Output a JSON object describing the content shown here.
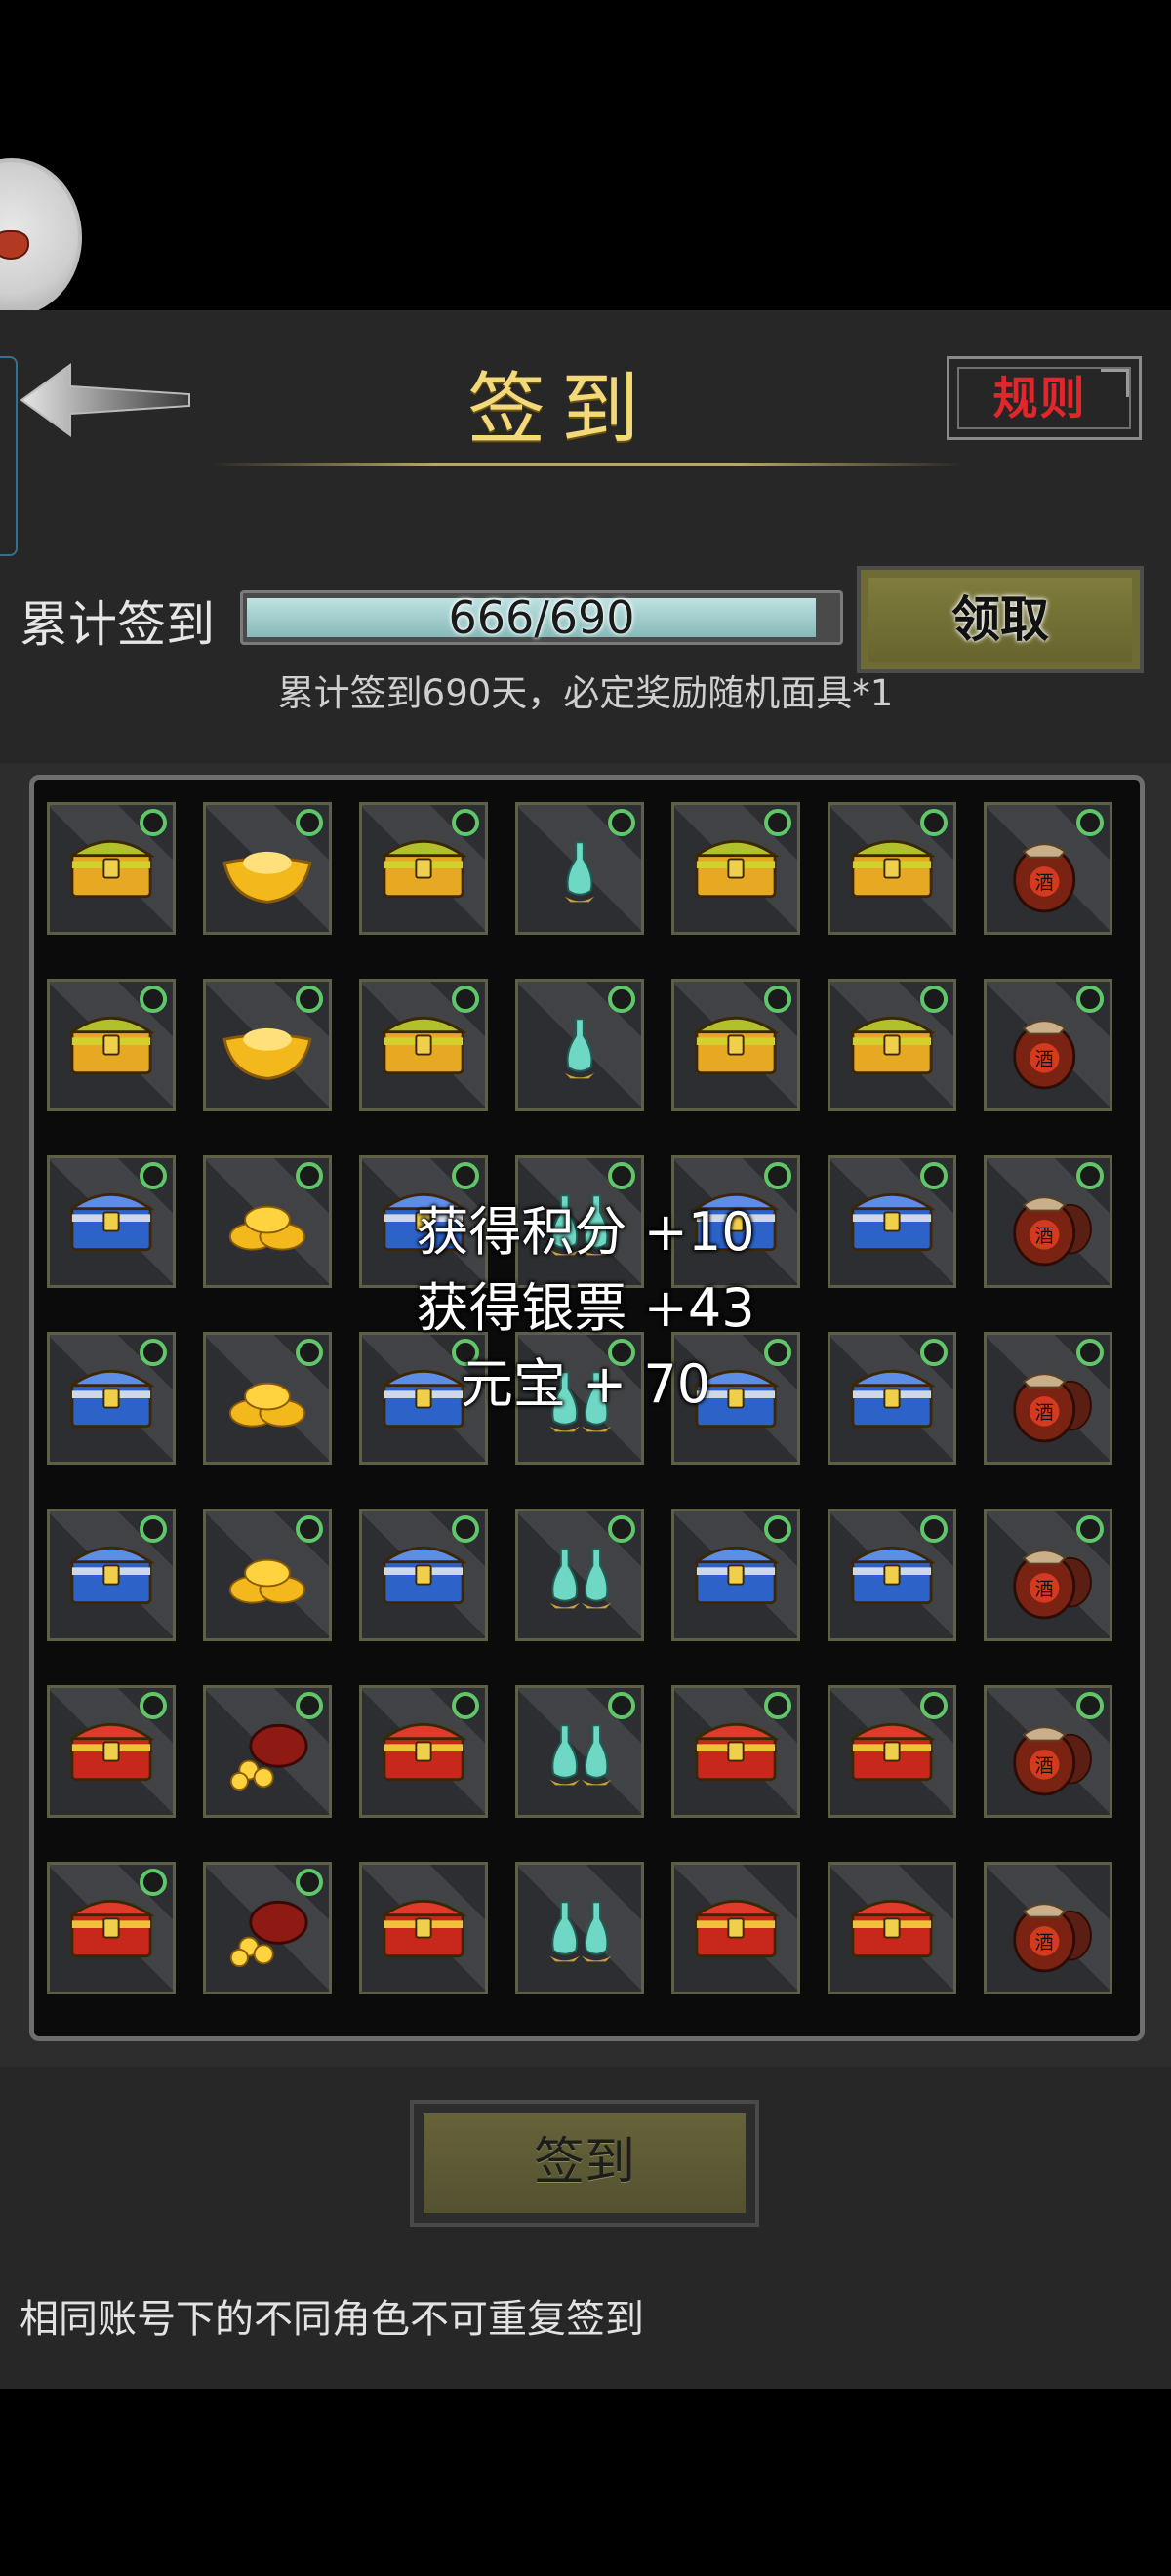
{
  "header": {
    "title": "签到",
    "rules_label": "规则"
  },
  "progress": {
    "label": "累计签到",
    "text": "666/690",
    "current": 666,
    "total": 690,
    "claim_label": "领取",
    "note": "累计签到690天，必定奖励随机面具*1"
  },
  "grid": {
    "rows": [
      [
        {
          "item": "chest-gold",
          "claimed": true
        },
        {
          "item": "gold-ingot",
          "claimed": true
        },
        {
          "item": "chest-gold",
          "claimed": true
        },
        {
          "item": "jade-vase",
          "claimed": true
        },
        {
          "item": "chest-gold",
          "claimed": true
        },
        {
          "item": "chest-gold",
          "claimed": true
        },
        {
          "item": "wine-jar",
          "claimed": true
        }
      ],
      [
        {
          "item": "chest-gold",
          "claimed": true
        },
        {
          "item": "gold-ingot",
          "claimed": true
        },
        {
          "item": "chest-gold",
          "claimed": true
        },
        {
          "item": "jade-vase",
          "claimed": true
        },
        {
          "item": "chest-gold",
          "claimed": true
        },
        {
          "item": "chest-gold",
          "claimed": true
        },
        {
          "item": "wine-jar",
          "claimed": true
        }
      ],
      [
        {
          "item": "chest-blue",
          "claimed": true
        },
        {
          "item": "gold-ingot-pile",
          "claimed": true
        },
        {
          "item": "chest-blue",
          "claimed": true
        },
        {
          "item": "jade-vases",
          "claimed": true
        },
        {
          "item": "chest-blue",
          "claimed": true
        },
        {
          "item": "chest-blue",
          "claimed": true
        },
        {
          "item": "wine-jars",
          "claimed": true
        }
      ],
      [
        {
          "item": "chest-blue",
          "claimed": true
        },
        {
          "item": "gold-ingot-pile",
          "claimed": true
        },
        {
          "item": "chest-blue",
          "claimed": true
        },
        {
          "item": "jade-vases",
          "claimed": true
        },
        {
          "item": "chest-blue",
          "claimed": true
        },
        {
          "item": "chest-blue",
          "claimed": true
        },
        {
          "item": "wine-jars",
          "claimed": true
        }
      ],
      [
        {
          "item": "chest-blue",
          "claimed": true
        },
        {
          "item": "gold-ingot-pile",
          "claimed": true
        },
        {
          "item": "chest-blue",
          "claimed": true
        },
        {
          "item": "jade-vases",
          "claimed": true
        },
        {
          "item": "chest-blue",
          "claimed": true
        },
        {
          "item": "chest-blue",
          "claimed": true
        },
        {
          "item": "wine-jars",
          "claimed": true
        }
      ],
      [
        {
          "item": "chest-red",
          "claimed": true
        },
        {
          "item": "coin-bag",
          "claimed": true
        },
        {
          "item": "chest-red",
          "claimed": true
        },
        {
          "item": "jade-vases",
          "claimed": true
        },
        {
          "item": "chest-red",
          "claimed": true
        },
        {
          "item": "chest-red",
          "claimed": true
        },
        {
          "item": "wine-jars",
          "claimed": true
        }
      ],
      [
        {
          "item": "chest-red",
          "claimed": true
        },
        {
          "item": "coin-bag",
          "claimed": true
        },
        {
          "item": "chest-red",
          "claimed": false
        },
        {
          "item": "jade-vases",
          "claimed": false
        },
        {
          "item": "chest-red",
          "claimed": false
        },
        {
          "item": "chest-red",
          "claimed": false
        },
        {
          "item": "wine-jars",
          "claimed": false
        }
      ]
    ]
  },
  "reward_popup": {
    "lines": [
      "获得积分 +10",
      "获得银票 +43",
      "元宝 + 70"
    ]
  },
  "actions": {
    "signin_label": "签到"
  },
  "footer": {
    "note": "相同账号下的不同角色不可重复签到"
  },
  "colors": {
    "title_gold": "#f3d97a",
    "rules_red": "#e3262b",
    "claim_olive": "#7f7c3c",
    "check_green": "#5fc66a",
    "bar_fill": "#a3cdcc"
  }
}
